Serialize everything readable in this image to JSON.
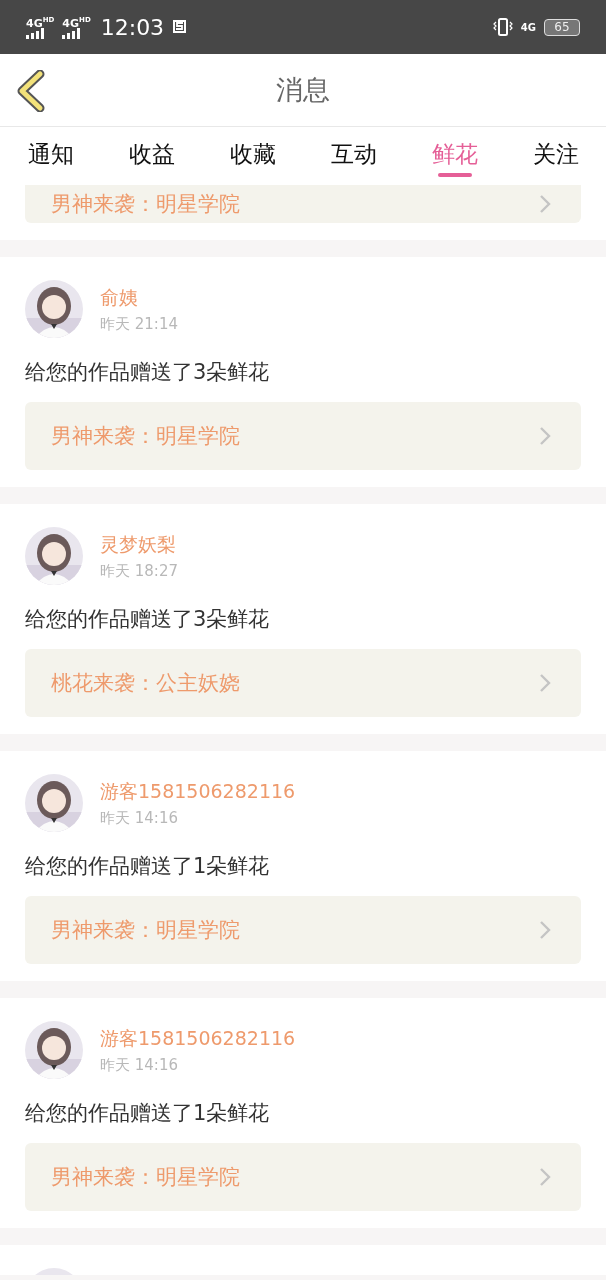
{
  "status_bar": {
    "sim_labels": [
      "4G$^{HD}$",
      "4G$^{HD}$"
    ],
    "time": "12:03",
    "data_label": "4G",
    "battery": "65"
  },
  "header": {
    "title": "消息"
  },
  "tabs": [
    {
      "label": "通知",
      "selected": false
    },
    {
      "label": "收益",
      "selected": false
    },
    {
      "label": "收藏",
      "selected": false
    },
    {
      "label": "互动",
      "selected": false
    },
    {
      "label": "鲜花",
      "selected": true
    },
    {
      "label": "关注",
      "selected": false
    }
  ],
  "partial_top_link": "男神来袭：明星学院",
  "messages": [
    {
      "avatar": {
        "kind": "picture"
      },
      "name": "俞姨",
      "time": "昨天 21:14",
      "text": "给您的作品赠送了3朵鲜花",
      "work": "男神来袭：明星学院"
    },
    {
      "avatar": {
        "kind": "picture"
      },
      "name": "灵梦妖梨",
      "time": "昨天 18:27",
      "text": "给您的作品赠送了3朵鲜花",
      "work": "桃花来袭：公主妖娆"
    },
    {
      "avatar": {
        "kind": "picture"
      },
      "name": "游客1581506282116",
      "time": "昨天 14:16",
      "text": "给您的作品赠送了1朵鲜花",
      "work": "男神来袭：明星学院"
    },
    {
      "avatar": {
        "kind": "picture"
      },
      "name": "游客1581506282116",
      "time": "昨天 14:16",
      "text": "给您的作品赠送了1朵鲜花",
      "work": "男神来袭：明星学院"
    },
    {
      "avatar": {
        "kind": "picture"
      }
    }
  ]
}
